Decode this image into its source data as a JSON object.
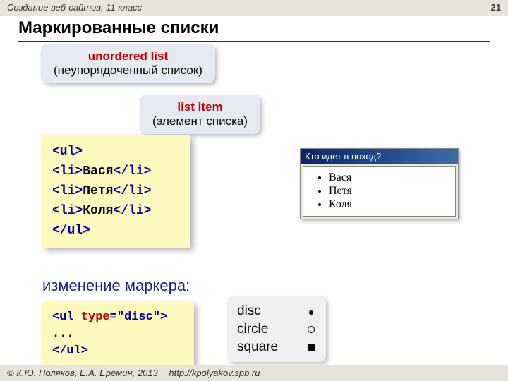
{
  "header": {
    "course": "Создание веб-сайтов, 11 класс",
    "page": "21"
  },
  "title": "Маркированные списки",
  "callouts": {
    "ul_head": "unordered list",
    "ul_sub": "(неупорядоченный список)",
    "li_head": "list item",
    "li_sub": "(элемент списка)"
  },
  "code_main": {
    "open_ul": "<ul>",
    "li_open": "<li>",
    "li_close": "</li>",
    "close_ul": "</ul>",
    "items": [
      "Вася",
      "Петя",
      "Коля"
    ]
  },
  "browser": {
    "title": "Кто идет в поход?",
    "items": [
      "Вася",
      "Петя",
      "Коля"
    ]
  },
  "change_marker_label": "изменение маркера:",
  "code_type": {
    "open": "<ul",
    "attr": " type",
    "eq": "=",
    "val": "\"disc\"",
    "gt": ">",
    "dots": "...",
    "close": "</ul>"
  },
  "markers": [
    {
      "name": "disc",
      "cls": "sym-disc"
    },
    {
      "name": "circle",
      "cls": "sym-circle"
    },
    {
      "name": "square",
      "cls": "sym-square"
    }
  ],
  "footer": {
    "copyright": "© К.Ю. Поляков, Е.А. Ерёмин, 2013",
    "url": "http://kpolyakov.spb.ru"
  }
}
